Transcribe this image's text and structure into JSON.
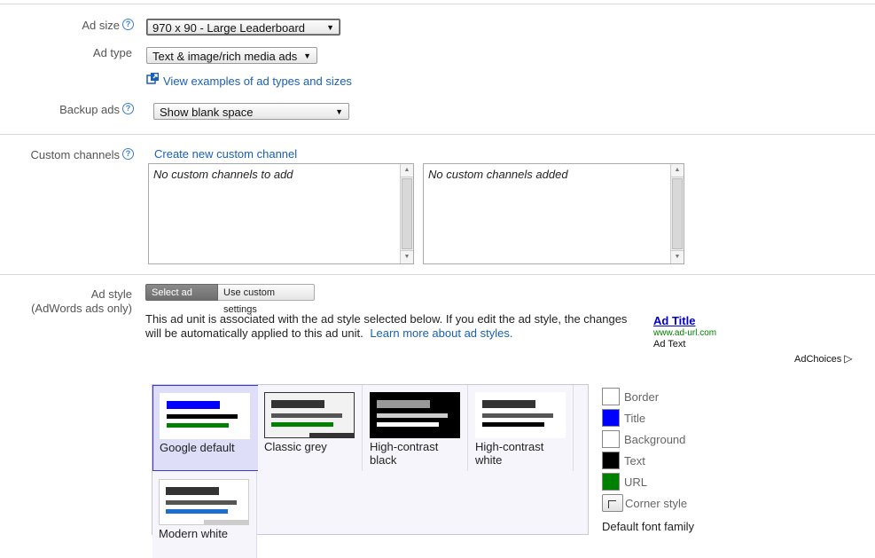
{
  "ad_size": {
    "label": "Ad size",
    "value": "970 x 90 - Large Leaderboard"
  },
  "ad_type": {
    "label": "Ad type",
    "value": "Text & image/rich media ads",
    "examples_link": "View examples of ad types and sizes"
  },
  "backup_ads": {
    "label": "Backup ads",
    "value": "Show blank space"
  },
  "custom_channels": {
    "label": "Custom channels",
    "create_link": "Create new custom channel",
    "available_placeholder": "No custom channels to add",
    "added_placeholder": "No custom channels added"
  },
  "ad_style": {
    "label": "Ad style",
    "sublabel": "(AdWords ads only)",
    "tabs": [
      "Select ad style",
      "Use custom settings"
    ],
    "description": "This ad unit is associated with the ad style selected below. If you edit the ad style, the changes will be automatically applied to this ad unit.",
    "learn_more_link": "Learn more about ad styles.",
    "preview": {
      "title": "Ad Title",
      "url": "www.ad-url.com",
      "text": "Ad Text"
    },
    "adchoices": "AdChoices",
    "styles": [
      {
        "name": "Google default"
      },
      {
        "name": "Classic grey"
      },
      {
        "name": "High-contrast black"
      },
      {
        "name": "High-contrast white"
      },
      {
        "name": "Modern white"
      }
    ],
    "colors": [
      {
        "label": "Border",
        "color": "#ffffff"
      },
      {
        "label": "Title",
        "color": "#0000ff"
      },
      {
        "label": "Background",
        "color": "#ffffff"
      },
      {
        "label": "Text",
        "color": "#000000"
      },
      {
        "label": "URL",
        "color": "#008000"
      }
    ],
    "corner_style_label": "Corner style",
    "font_family_label": "Default font family"
  }
}
